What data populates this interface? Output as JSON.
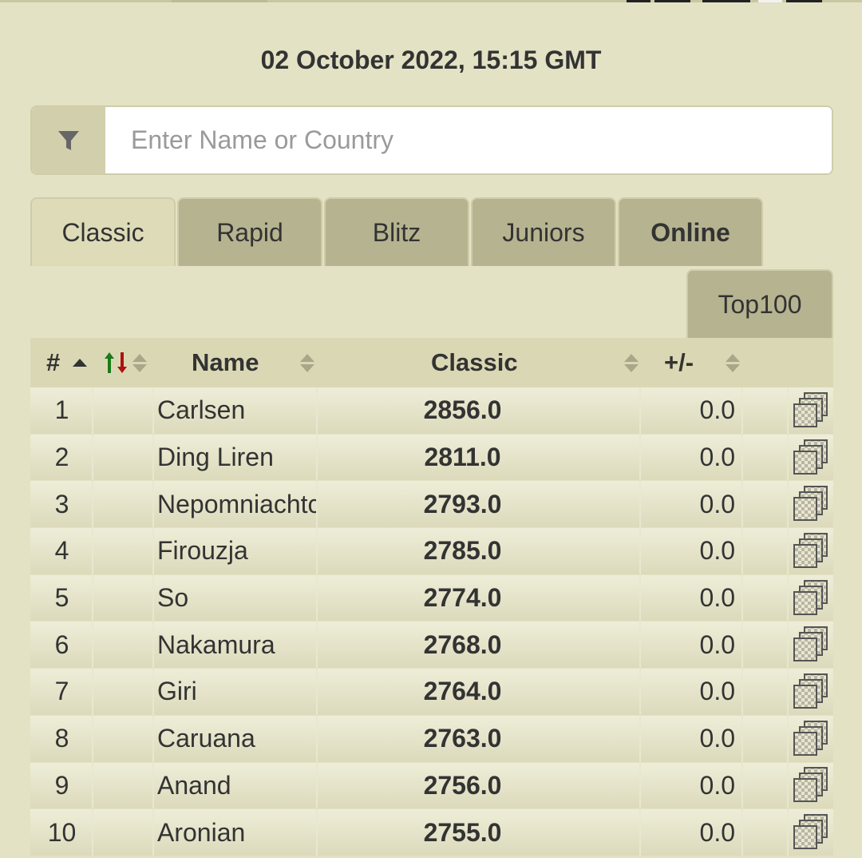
{
  "date": "02 October 2022, 15:15 GMT",
  "search": {
    "placeholder": "Enter Name or Country",
    "value": ""
  },
  "tabs": [
    {
      "label": "Classic",
      "active": true
    },
    {
      "label": "Rapid",
      "active": false
    },
    {
      "label": "Blitz",
      "active": false
    },
    {
      "label": "Juniors",
      "active": false
    },
    {
      "label": "Online",
      "active": false
    }
  ],
  "subtab": {
    "label": "Top100"
  },
  "table": {
    "headers": {
      "rank": "#",
      "name": "Name",
      "rating": "Classic",
      "diff": "+/-"
    },
    "rows": [
      {
        "rank": "1",
        "name": "Carlsen",
        "rating": "2856.0",
        "diff": "0.0"
      },
      {
        "rank": "2",
        "name": "Ding Liren",
        "rating": "2811.0",
        "diff": "0.0"
      },
      {
        "rank": "3",
        "name": "Nepomniachtchi",
        "rating": "2793.0",
        "diff": "0.0"
      },
      {
        "rank": "4",
        "name": "Firouzja",
        "rating": "2785.0",
        "diff": "0.0"
      },
      {
        "rank": "5",
        "name": "So",
        "rating": "2774.0",
        "diff": "0.0"
      },
      {
        "rank": "6",
        "name": "Nakamura",
        "rating": "2768.0",
        "diff": "0.0"
      },
      {
        "rank": "7",
        "name": "Giri",
        "rating": "2764.0",
        "diff": "0.0"
      },
      {
        "rank": "8",
        "name": "Caruana",
        "rating": "2763.0",
        "diff": "0.0"
      },
      {
        "rank": "9",
        "name": "Anand",
        "rating": "2756.0",
        "diff": "0.0"
      },
      {
        "rank": "10",
        "name": "Aronian",
        "rating": "2755.0",
        "diff": "0.0"
      }
    ]
  },
  "icons": {
    "filter": "filter-icon",
    "row_action": "chessboard-copy-icon",
    "rank_change": "up-down-arrows-icon"
  },
  "colors": {
    "up_arrow": "#1a7a1a",
    "down_arrow": "#b01010",
    "background": "#e3e2c4"
  }
}
